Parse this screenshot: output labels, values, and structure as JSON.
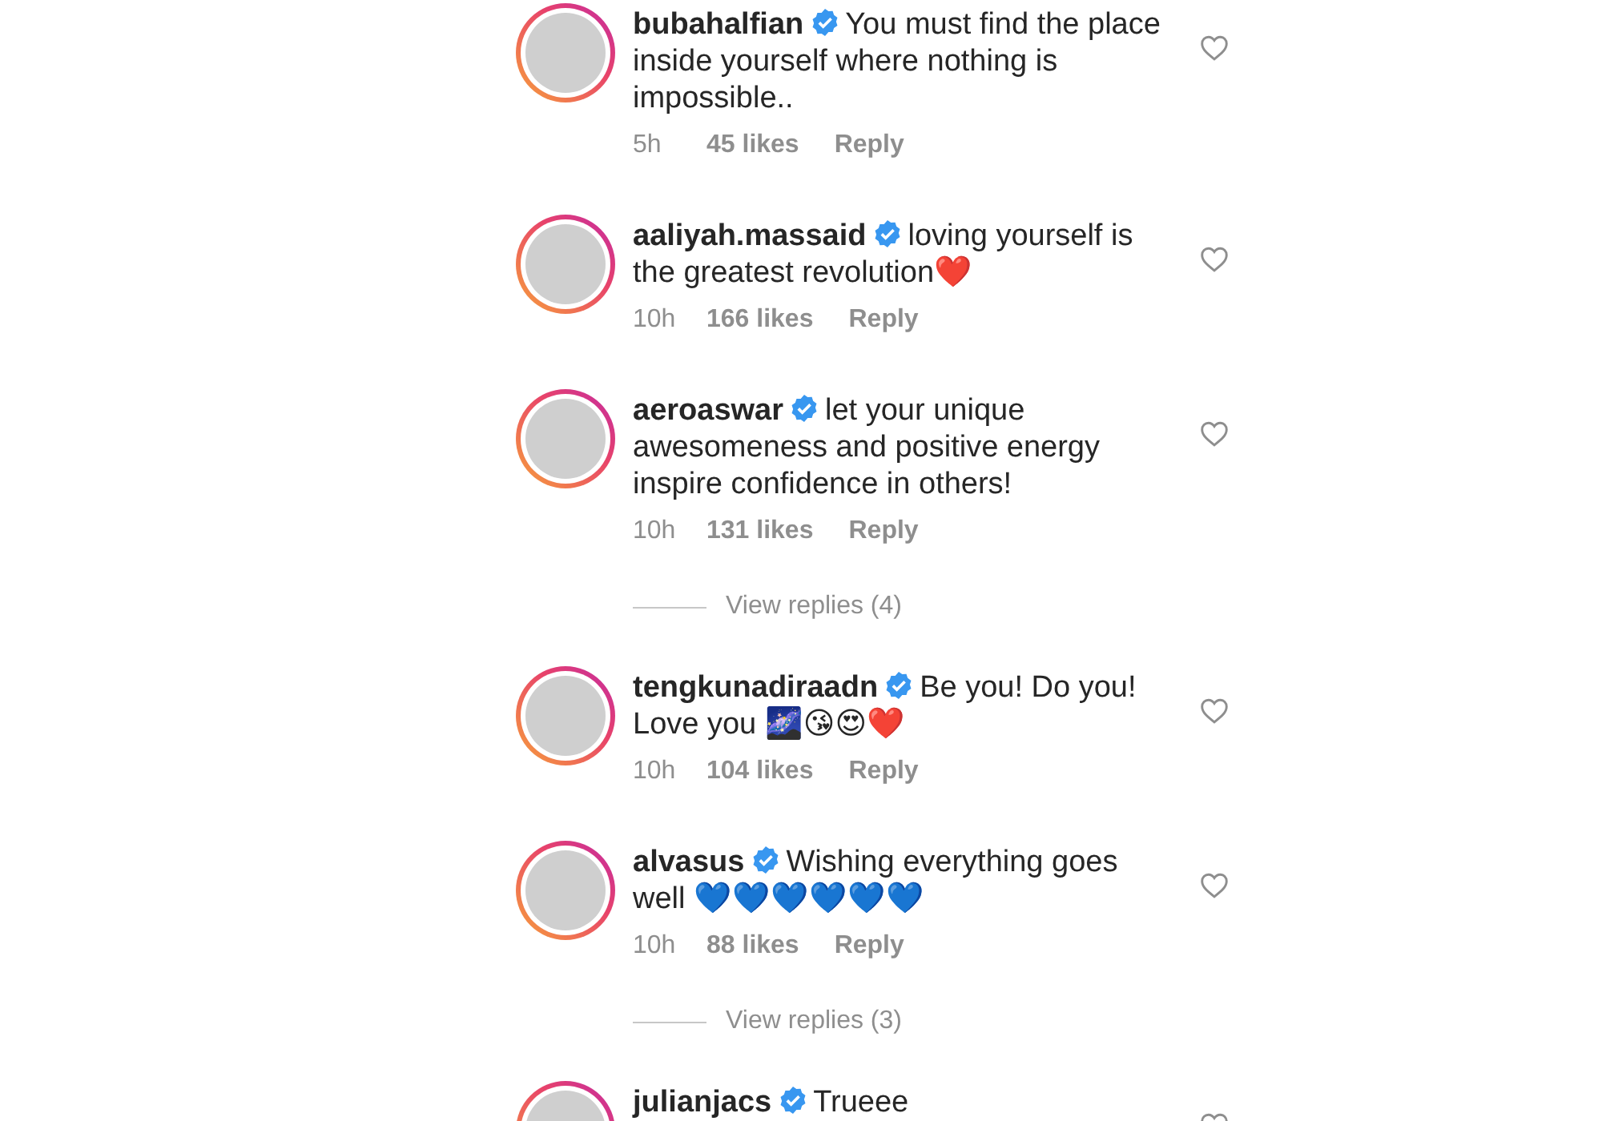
{
  "feed": [
    {
      "kind": "comment",
      "username": "bubahalfian",
      "verified": true,
      "text": "You must find the place inside yourself where nothing is impossible..",
      "time": "5h",
      "likes": "45 likes",
      "reply": "Reply",
      "liked": false
    },
    {
      "kind": "comment",
      "username": "aaliyah.massaid",
      "verified": true,
      "text": "loving yourself is the greatest revolution❤️",
      "time": "10h",
      "likes": "166 likes",
      "reply": "Reply",
      "liked": false
    },
    {
      "kind": "comment",
      "username": "aeroaswar",
      "verified": true,
      "text": "let your unique awesomeness and positive energy inspire confidence in others!",
      "time": "10h",
      "likes": "131 likes",
      "reply": "Reply",
      "liked": false
    },
    {
      "kind": "view_replies",
      "label": "View replies (4)"
    },
    {
      "kind": "comment",
      "username": "tengkunadiraadn",
      "verified": true,
      "text": "Be you! Do you! Love you 🌌😘😍❤️",
      "time": "10h",
      "likes": "104 likes",
      "reply": "Reply",
      "liked": false
    },
    {
      "kind": "comment",
      "username": "alvasus",
      "verified": true,
      "text": "Wishing everything goes well 💙💙💙💙💙💙",
      "time": "10h",
      "likes": "88 likes",
      "reply": "Reply",
      "liked": false
    },
    {
      "kind": "view_replies",
      "label": "View replies (3)"
    },
    {
      "kind": "comment",
      "username": "julianjacs",
      "verified": true,
      "text": "Trueee",
      "liked": false
    }
  ]
}
